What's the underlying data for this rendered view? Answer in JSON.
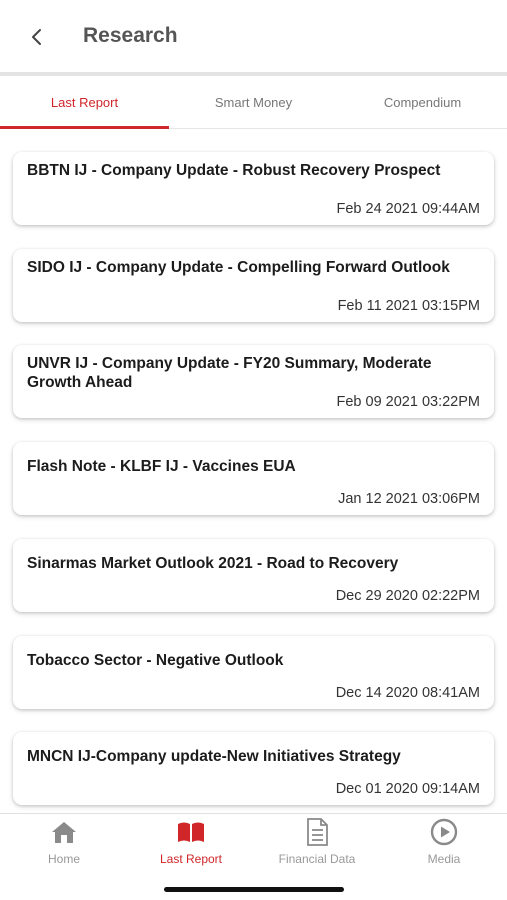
{
  "header": {
    "title": "Research",
    "back_icon": "chevron-left-icon"
  },
  "tabs": [
    {
      "label": "Last Report",
      "active": true
    },
    {
      "label": "Smart Money",
      "active": false
    },
    {
      "label": "Compendium",
      "active": false
    }
  ],
  "reports": [
    {
      "title": "BBTN IJ - Company Update - Robust Recovery Prospect",
      "date": "Feb 24 2021 09:44AM"
    },
    {
      "title": "SIDO IJ - Company Update - Compelling Forward Outlook",
      "date": "Feb 11 2021 03:15PM"
    },
    {
      "title": "UNVR IJ - Company Update - FY20 Summary, Moderate Growth Ahead",
      "date": "Feb 09 2021 03:22PM"
    },
    {
      "title": "Flash Note - KLBF IJ - Vaccines EUA",
      "date": "Jan 12 2021 03:06PM"
    },
    {
      "title": "Sinarmas Market Outlook 2021 - Road to Recovery",
      "date": "Dec 29 2020 02:22PM"
    },
    {
      "title": "Tobacco Sector - Negative Outlook",
      "date": "Dec 14 2020 08:41AM"
    },
    {
      "title": "MNCN IJ-Company update-New Initiatives Strategy",
      "date": "Dec 01 2020 09:14AM"
    }
  ],
  "bottom_nav": [
    {
      "label": "Home",
      "icon": "home-icon",
      "active": false
    },
    {
      "label": "Last Report",
      "icon": "book-icon",
      "active": true
    },
    {
      "label": "Financial Data",
      "icon": "document-icon",
      "active": false
    },
    {
      "label": "Media",
      "icon": "play-icon",
      "active": false
    }
  ],
  "colors": {
    "accent": "#d0262a",
    "inactive": "#999999",
    "title": "#555555"
  }
}
